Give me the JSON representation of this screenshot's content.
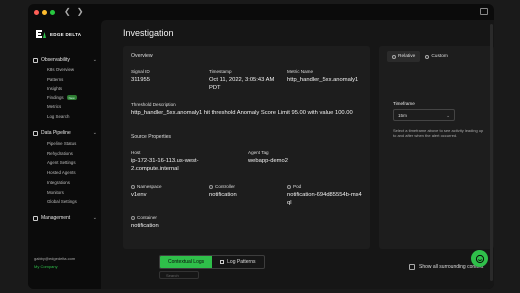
{
  "window": {
    "traffic_colors": [
      "#ff5f57",
      "#febc2e",
      "#28c840"
    ]
  },
  "brand": {
    "name": "EDGE DELTA",
    "accent": "#2fbf4a"
  },
  "sidebar": {
    "observability": {
      "label": "Observability",
      "items": [
        {
          "label": "K8s Overview"
        },
        {
          "label": "Patterns"
        },
        {
          "label": "Insights"
        },
        {
          "label": "Findings",
          "badge": "New"
        },
        {
          "label": "Metrics"
        },
        {
          "label": "Log Search"
        }
      ]
    },
    "pipeline": {
      "label": "Data Pipeline",
      "items": [
        {
          "label": "Pipeline Status"
        },
        {
          "label": "Rehydrations"
        },
        {
          "label": "Agent Settings"
        },
        {
          "label": "Hosted Agents"
        },
        {
          "label": "Integrations"
        },
        {
          "label": "Monitors"
        },
        {
          "label": "Global Settings"
        }
      ]
    },
    "management": {
      "label": "Management"
    },
    "user": {
      "email": "gabby@edgedelta.com",
      "company": "My Company"
    }
  },
  "page": {
    "title": "Investigation"
  },
  "overview": {
    "heading": "Overview",
    "signal_id_label": "Signal ID",
    "signal_id": "311955",
    "timestamp_label": "Timestamp",
    "timestamp": "Oct 11, 2022, 3:05:43 AM PDT",
    "metric_label": "Metric Name",
    "metric": "http_handler_5xx.anomaly1",
    "threshold_label": "Threshold Description",
    "threshold": "http_handler_5xx.anomaly1 hit threshold Anomaly Score Limit 95.00 with value 100.00",
    "source_heading": "Source Properties",
    "host_label": "Host",
    "host": "ip-172-31-16-113.us-west-2.compute.internal",
    "agent_label": "Agent Tag",
    "agent": "webapp-demo2",
    "namespace_label": "Namespace",
    "namespace": "v1env",
    "controller_label": "Controller",
    "controller": "notification",
    "pod_label": "Pod",
    "pod": "notification-694d85554b-ms4ql",
    "container_label": "Container",
    "container": "notification"
  },
  "timeframe": {
    "tab_relative": "Relative",
    "tab_custom": "Custom",
    "label": "Timeframe",
    "value": "15m",
    "help": "Select a timeframe above to see activity leading up to and after when the alert occurred."
  },
  "logs": {
    "tab_contextual": "Contextual Logs",
    "tab_patterns": "Log Patterns",
    "search_placeholder": "Search",
    "show_context": "Show all surrounding context"
  }
}
